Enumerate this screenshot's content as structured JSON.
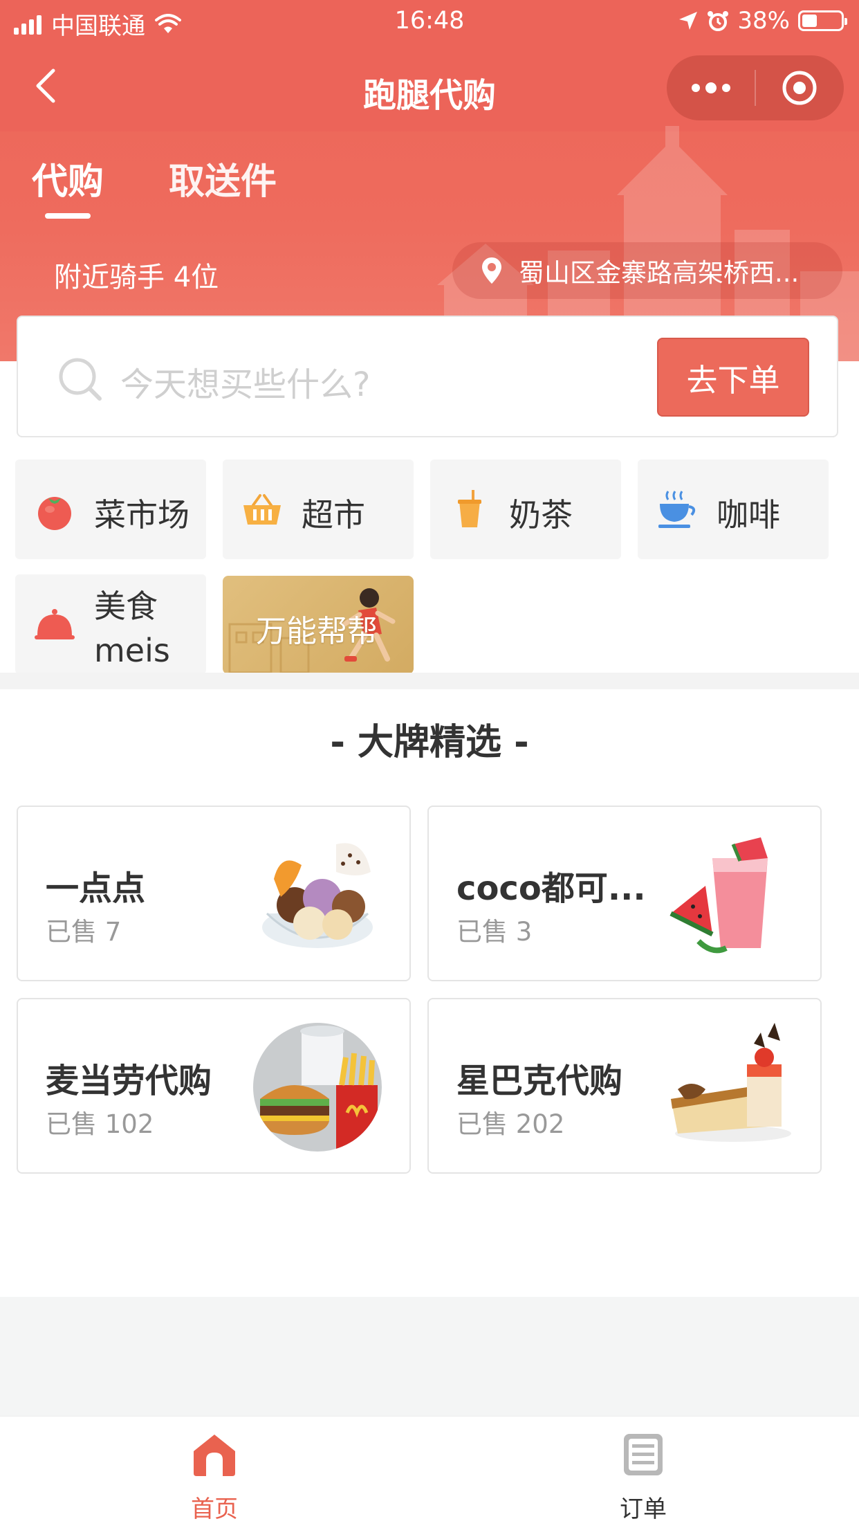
{
  "status_bar": {
    "carrier": "中国联通",
    "time": "16:48",
    "battery": "38%",
    "battery_level": 0.38
  },
  "nav": {
    "title": "跑腿代购",
    "back_icon": "chevron-left-icon",
    "more_icon": "more-dots-icon",
    "close_icon": "target-circle-icon"
  },
  "tabs": [
    {
      "label": "代购",
      "active": true
    },
    {
      "label": "取送件",
      "active": false
    }
  ],
  "riders_text": "附近骑手 4位",
  "location_text": "蜀山区金寨路高架桥西...",
  "search": {
    "placeholder": "今天想买些什么?",
    "order_button": "去下单"
  },
  "categories": [
    {
      "label": "菜市场",
      "icon": "tomato-icon"
    },
    {
      "label": "超市",
      "icon": "basket-icon"
    },
    {
      "label": "奶茶",
      "icon": "milk-tea-icon"
    },
    {
      "label": "咖啡",
      "icon": "coffee-cup-icon"
    },
    {
      "label": "美食\nmeis",
      "icon": "food-cloche-icon"
    },
    {
      "label": "万能帮帮",
      "icon": "runner-icon"
    }
  ],
  "section_title": "- 大牌精选 -",
  "brands": [
    {
      "name": "一点点",
      "sold": "已售 7",
      "image": "ice-cream-image"
    },
    {
      "name": "coco都可...",
      "sold": "已售 3",
      "image": "watermelon-drink-image"
    },
    {
      "name": "麦当劳代购",
      "sold": "已售 102",
      "image": "burger-fries-image"
    },
    {
      "name": "星巴克代购",
      "sold": "已售 202",
      "image": "cake-image"
    }
  ],
  "tabbar": [
    {
      "label": "首页",
      "icon": "home-icon",
      "active": true,
      "color": "#e9624f"
    },
    {
      "label": "订单",
      "icon": "order-list-icon",
      "active": false,
      "color": "#333333"
    }
  ],
  "colors": {
    "primary": "#ec6558",
    "button": "#ec6a5b"
  }
}
